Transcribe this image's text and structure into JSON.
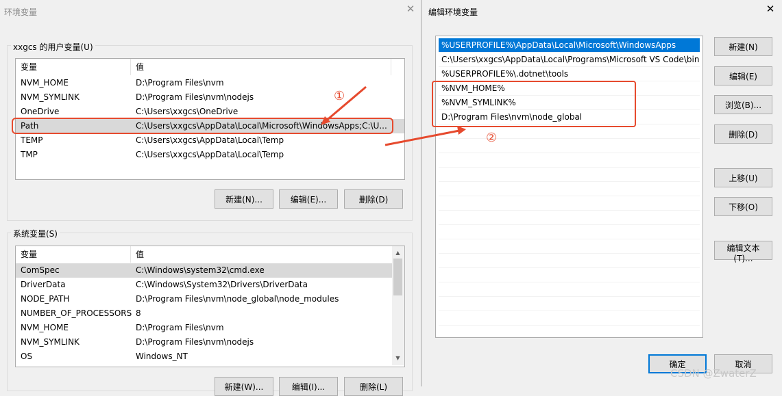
{
  "left_window": {
    "title": "环境变量",
    "close_glyph": "✕",
    "user_section": {
      "label": "xxgcs 的用户变量(U)",
      "headers": [
        "变量",
        "值"
      ],
      "rows": [
        {
          "name": "NVM_HOME",
          "value": "D:\\Program Files\\nvm"
        },
        {
          "name": "NVM_SYMLINK",
          "value": "D:\\Program Files\\nvm\\nodejs"
        },
        {
          "name": "OneDrive",
          "value": "C:\\Users\\xxgcs\\OneDrive"
        },
        {
          "name": "Path",
          "value": "C:\\Users\\xxgcs\\AppData\\Local\\Microsoft\\WindowsApps;C:\\U..."
        },
        {
          "name": "TEMP",
          "value": "C:\\Users\\xxgcs\\AppData\\Local\\Temp"
        },
        {
          "name": "TMP",
          "value": "C:\\Users\\xxgcs\\AppData\\Local\\Temp"
        }
      ],
      "buttons": {
        "new": "新建(N)...",
        "edit": "编辑(E)...",
        "delete": "删除(D)"
      }
    },
    "system_section": {
      "label": "系统变量(S)",
      "headers": [
        "变量",
        "值"
      ],
      "rows": [
        {
          "name": "ComSpec",
          "value": "C:\\Windows\\system32\\cmd.exe"
        },
        {
          "name": "DriverData",
          "value": "C:\\Windows\\System32\\Drivers\\DriverData"
        },
        {
          "name": "NODE_PATH",
          "value": "D:\\Program Files\\nvm\\node_global\\node_modules"
        },
        {
          "name": "NUMBER_OF_PROCESSORS",
          "value": "8"
        },
        {
          "name": "NVM_HOME",
          "value": "D:\\Program Files\\nvm"
        },
        {
          "name": "NVM_SYMLINK",
          "value": "D:\\Program Files\\nvm\\nodejs"
        },
        {
          "name": "OS",
          "value": "Windows_NT"
        }
      ],
      "buttons": {
        "new": "新建(W)...",
        "edit": "编辑(I)...",
        "delete": "删除(L)"
      }
    }
  },
  "edit_dialog": {
    "title": "编辑环境变量",
    "close_glyph": "✕",
    "entries": [
      "%USERPROFILE%\\AppData\\Local\\Microsoft\\WindowsApps",
      "C:\\Users\\xxgcs\\AppData\\Local\\Programs\\Microsoft VS Code\\bin",
      "%USERPROFILE%\\.dotnet\\tools",
      "%NVM_HOME%",
      "%NVM_SYMLINK%",
      "D:\\Program Files\\nvm\\node_global"
    ],
    "buttons": {
      "new": "新建(N)",
      "edit": "编辑(E)",
      "browse": "浏览(B)...",
      "delete": "删除(D)",
      "move_up": "上移(U)",
      "move_down": "下移(O)",
      "edit_text": "编辑文本(T)...",
      "ok": "确定",
      "cancel": "取消"
    }
  },
  "annotations": {
    "marker_1": "①",
    "marker_2": "②",
    "color": "#e64a2e"
  },
  "watermark": "CSDN @ZwaterZ"
}
